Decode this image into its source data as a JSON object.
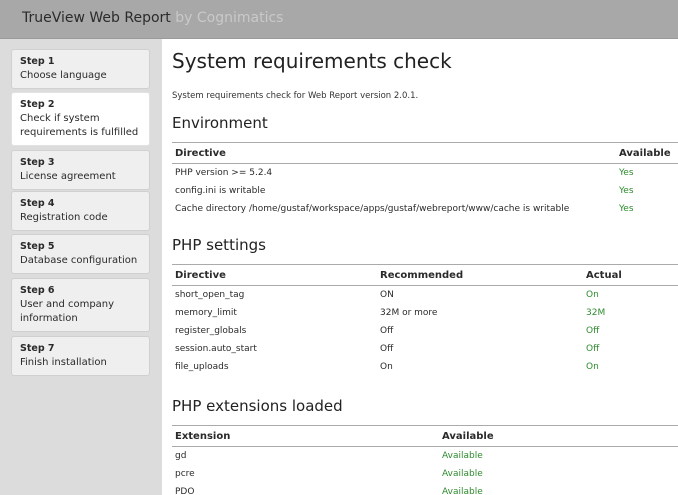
{
  "header": {
    "title": "TrueView Web Report",
    "subtitle": "by Cognimatics"
  },
  "sidebar": {
    "steps": [
      {
        "num": "Step 1",
        "label": "Choose language"
      },
      {
        "num": "Step 2",
        "label": "Check if system requirements is fulfilled"
      },
      {
        "num": "Step 3",
        "label": "License agreement"
      },
      {
        "num": "Step 4",
        "label": "Registration code"
      },
      {
        "num": "Step 5",
        "label": "Database configuration"
      },
      {
        "num": "Step 6",
        "label": "User and company information"
      },
      {
        "num": "Step 7",
        "label": "Finish installation"
      }
    ]
  },
  "main": {
    "title": "System requirements check",
    "intro": "System requirements check for Web Report version 2.0.1.",
    "environment": {
      "heading": "Environment",
      "headers": [
        "Directive",
        "Available"
      ],
      "rows": [
        [
          "PHP version >= 5.2.4",
          "Yes"
        ],
        [
          "config.ini is writable",
          "Yes"
        ],
        [
          "Cache directory /home/gustaf/workspace/apps/gustaf/webreport/www/cache is writable",
          "Yes"
        ]
      ]
    },
    "php_settings": {
      "heading": "PHP settings",
      "headers": [
        "Directive",
        "Recommended",
        "Actual"
      ],
      "rows": [
        [
          "short_open_tag",
          "ON",
          "On"
        ],
        [
          "memory_limit",
          "32M or more",
          "32M"
        ],
        [
          "register_globals",
          "Off",
          "Off"
        ],
        [
          "session.auto_start",
          "Off",
          "Off"
        ],
        [
          "file_uploads",
          "On",
          "On"
        ]
      ]
    },
    "extensions": {
      "heading": "PHP extensions loaded",
      "headers": [
        "Extension",
        "Available"
      ],
      "rows": [
        [
          "gd",
          "Available"
        ],
        [
          "pcre",
          "Available"
        ],
        [
          "PDO",
          "Available"
        ]
      ]
    }
  },
  "colors": {
    "ok": "#2e8b2e",
    "topbar": "#a8a8a8",
    "sidebar": "#dcdcdc"
  }
}
